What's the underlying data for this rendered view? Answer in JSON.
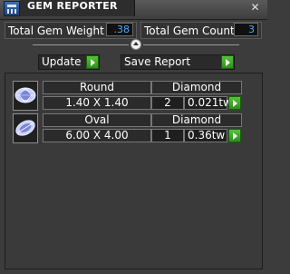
{
  "window": {
    "title": "GEM REPORTER",
    "close_glyph": "✕",
    "icon": "gem-reporter-app-icon"
  },
  "stats": {
    "total_weight_label": "Total Gem Weight",
    "total_weight_value": ".38",
    "total_count_label": "Total Gem Count",
    "total_count_value": "3"
  },
  "toolbar": {
    "update_label": "Update",
    "save_report_label": "Save Report"
  },
  "gems": [
    {
      "shape": "Round",
      "type": "Diamond",
      "size": "1.40 X 1.40",
      "count": "2",
      "weight": "0.021tw",
      "thumb_icon": "round-gem-icon"
    },
    {
      "shape": "Oval",
      "type": "Diamond",
      "size": "6.00 X 4.00",
      "count": "1",
      "weight": "0.36tw",
      "thumb_icon": "oval-gem-icon"
    }
  ],
  "colors": {
    "accent_green": "#3aa52a",
    "value_blue": "#4aa8ff",
    "background": "#3c3c3c"
  }
}
